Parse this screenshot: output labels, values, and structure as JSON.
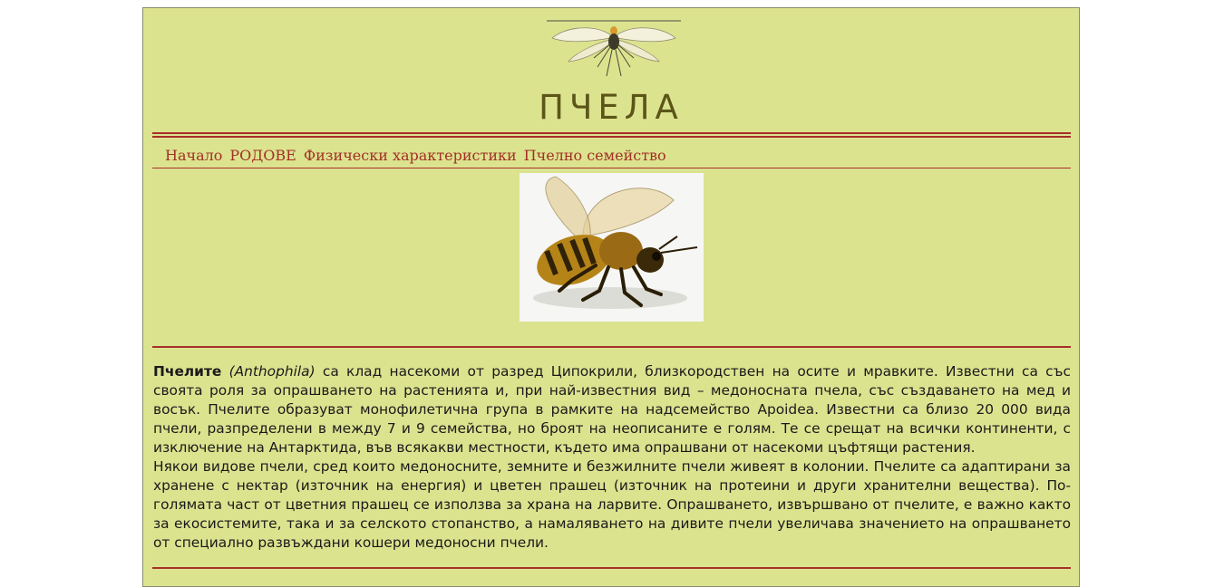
{
  "header": {
    "title": "ПЧЕЛА",
    "logo_icon": "winged-insect-icon"
  },
  "nav": {
    "items": [
      {
        "label": "Начало"
      },
      {
        "label": "РОДОВЕ"
      },
      {
        "label": "Физически характеристики"
      },
      {
        "label": "Пчелно семейство"
      }
    ]
  },
  "main": {
    "image_icon": "honey-bee-photo",
    "intro": {
      "bold": "Пчелите",
      "italic": "(Anthophila)",
      "rest": " са клад насекоми от разред Ципокрили, близкородствен на осите и мравките. Известни са със своята роля за опрашването на растенията и, при най-известния вид – медоносната пчела, със създаването на мед и восък. Пчелите образуват монофилетична група в рамките на надсемейство Apoidea. Известни са близо 20 000 вида пчели, разпределени в между 7 и 9 семейства, но броят на неописаните е голям. Те се срещат на всички континенти, с изключение на Антарктида, във всякакви местности, където има опрашвани от насекоми цъфтящи растения."
    },
    "paragraph2": "Някои видове пчели, сред които медоносните, земните и безжилните пчели живеят в колонии. Пчелите са адаптирани за хранене с нектар (източник на енергия) и цветен прашец (източник на протеини и други хранителни вещества). По-голямата част от цветния прашец се използва за храна на ларвите. Опрашването, извършвано от пчелите, е важно както за екосистемите, така и за селското стопанство, а намаляването на дивите пчели увеличава значението на опрашването от специално развъждани кошери медоносни пчели."
  },
  "colors": {
    "background": "#dce38f",
    "accent": "#a6302a",
    "title": "#5c5518",
    "link": "#a23126"
  }
}
